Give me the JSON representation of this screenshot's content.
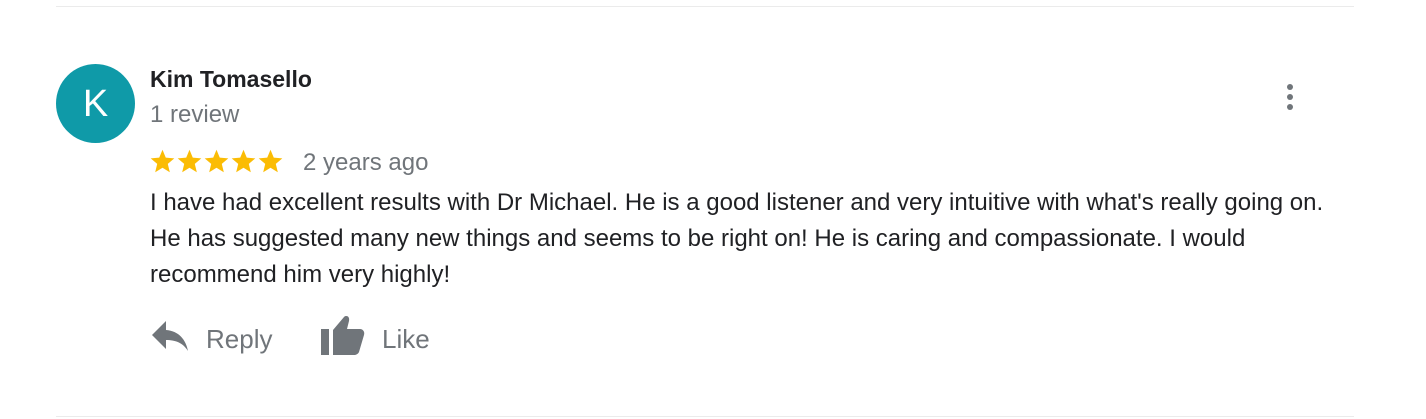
{
  "review": {
    "avatar_initial": "K",
    "avatar_color": "#0f9aa8",
    "author_name": "Kim Tomasello",
    "review_count": "1 review",
    "rating": 5,
    "rating_max": 5,
    "star_color": "#fbbc04",
    "date": "2 years ago",
    "text": "I have had excellent results with Dr Michael. He is a good listener and very intuitive with what's really going on. He has suggested many new things and seems to be right on! He is caring and compassionate. I would recommend him very highly!",
    "more_icon": "more-vert-icon"
  },
  "actions": {
    "reply_label": "Reply",
    "reply_icon": "reply-arrow-icon",
    "like_label": "Like",
    "like_icon": "thumbs-up-icon"
  }
}
